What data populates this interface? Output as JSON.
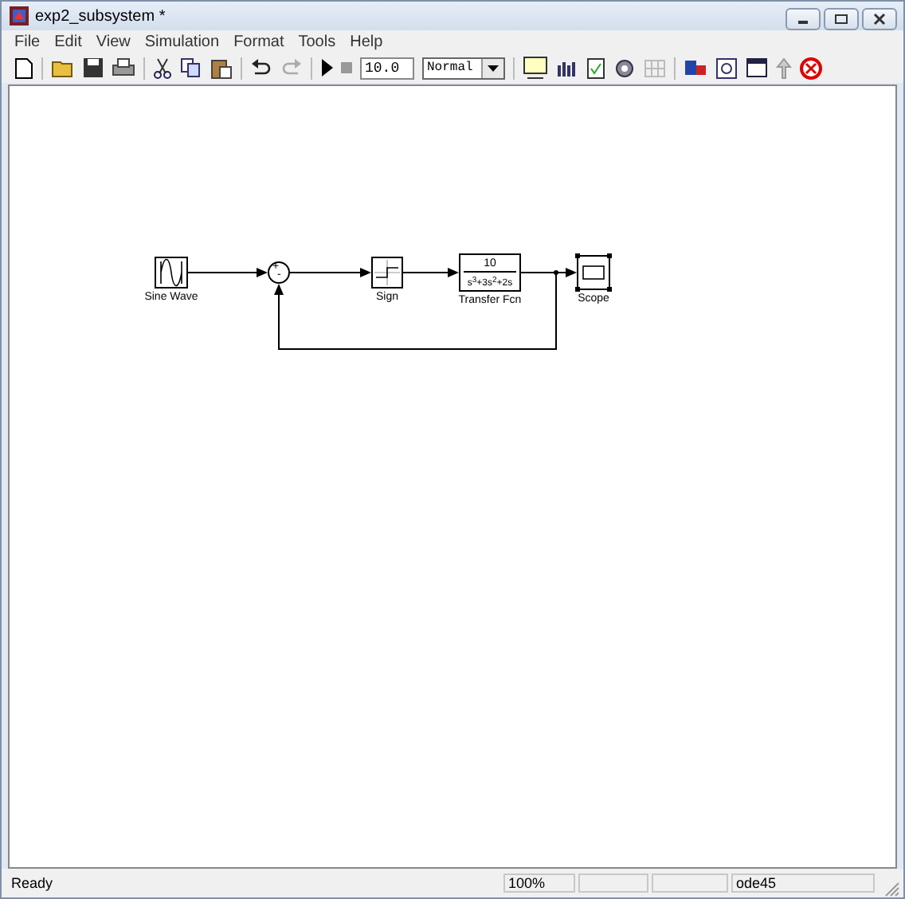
{
  "window": {
    "title": "exp2_subsystem *"
  },
  "menu": [
    {
      "label": "File"
    },
    {
      "label": "Edit"
    },
    {
      "label": "View"
    },
    {
      "label": "Simulation"
    },
    {
      "label": "Format"
    },
    {
      "label": "Tools"
    },
    {
      "label": "Help"
    }
  ],
  "toolbar": {
    "stop_time": "10.0",
    "mode": "Normal"
  },
  "blocks": [
    {
      "kind": "sine",
      "label": "Sine Wave",
      "selected": false
    },
    {
      "kind": "sum",
      "signs": [
        "+",
        "-"
      ],
      "selected": false
    },
    {
      "kind": "sign",
      "label": "Sign",
      "selected": false
    },
    {
      "kind": "tf",
      "label": "Transfer Fcn",
      "numerator": "10",
      "denominator": "s$^{3}$+3s$^{2}$+2s",
      "selected": false
    },
    {
      "kind": "scope",
      "label": "Scope",
      "selected": true
    }
  ],
  "status_bar": {
    "message": "Ready",
    "zoom": "100%",
    "solver": "ode45"
  }
}
